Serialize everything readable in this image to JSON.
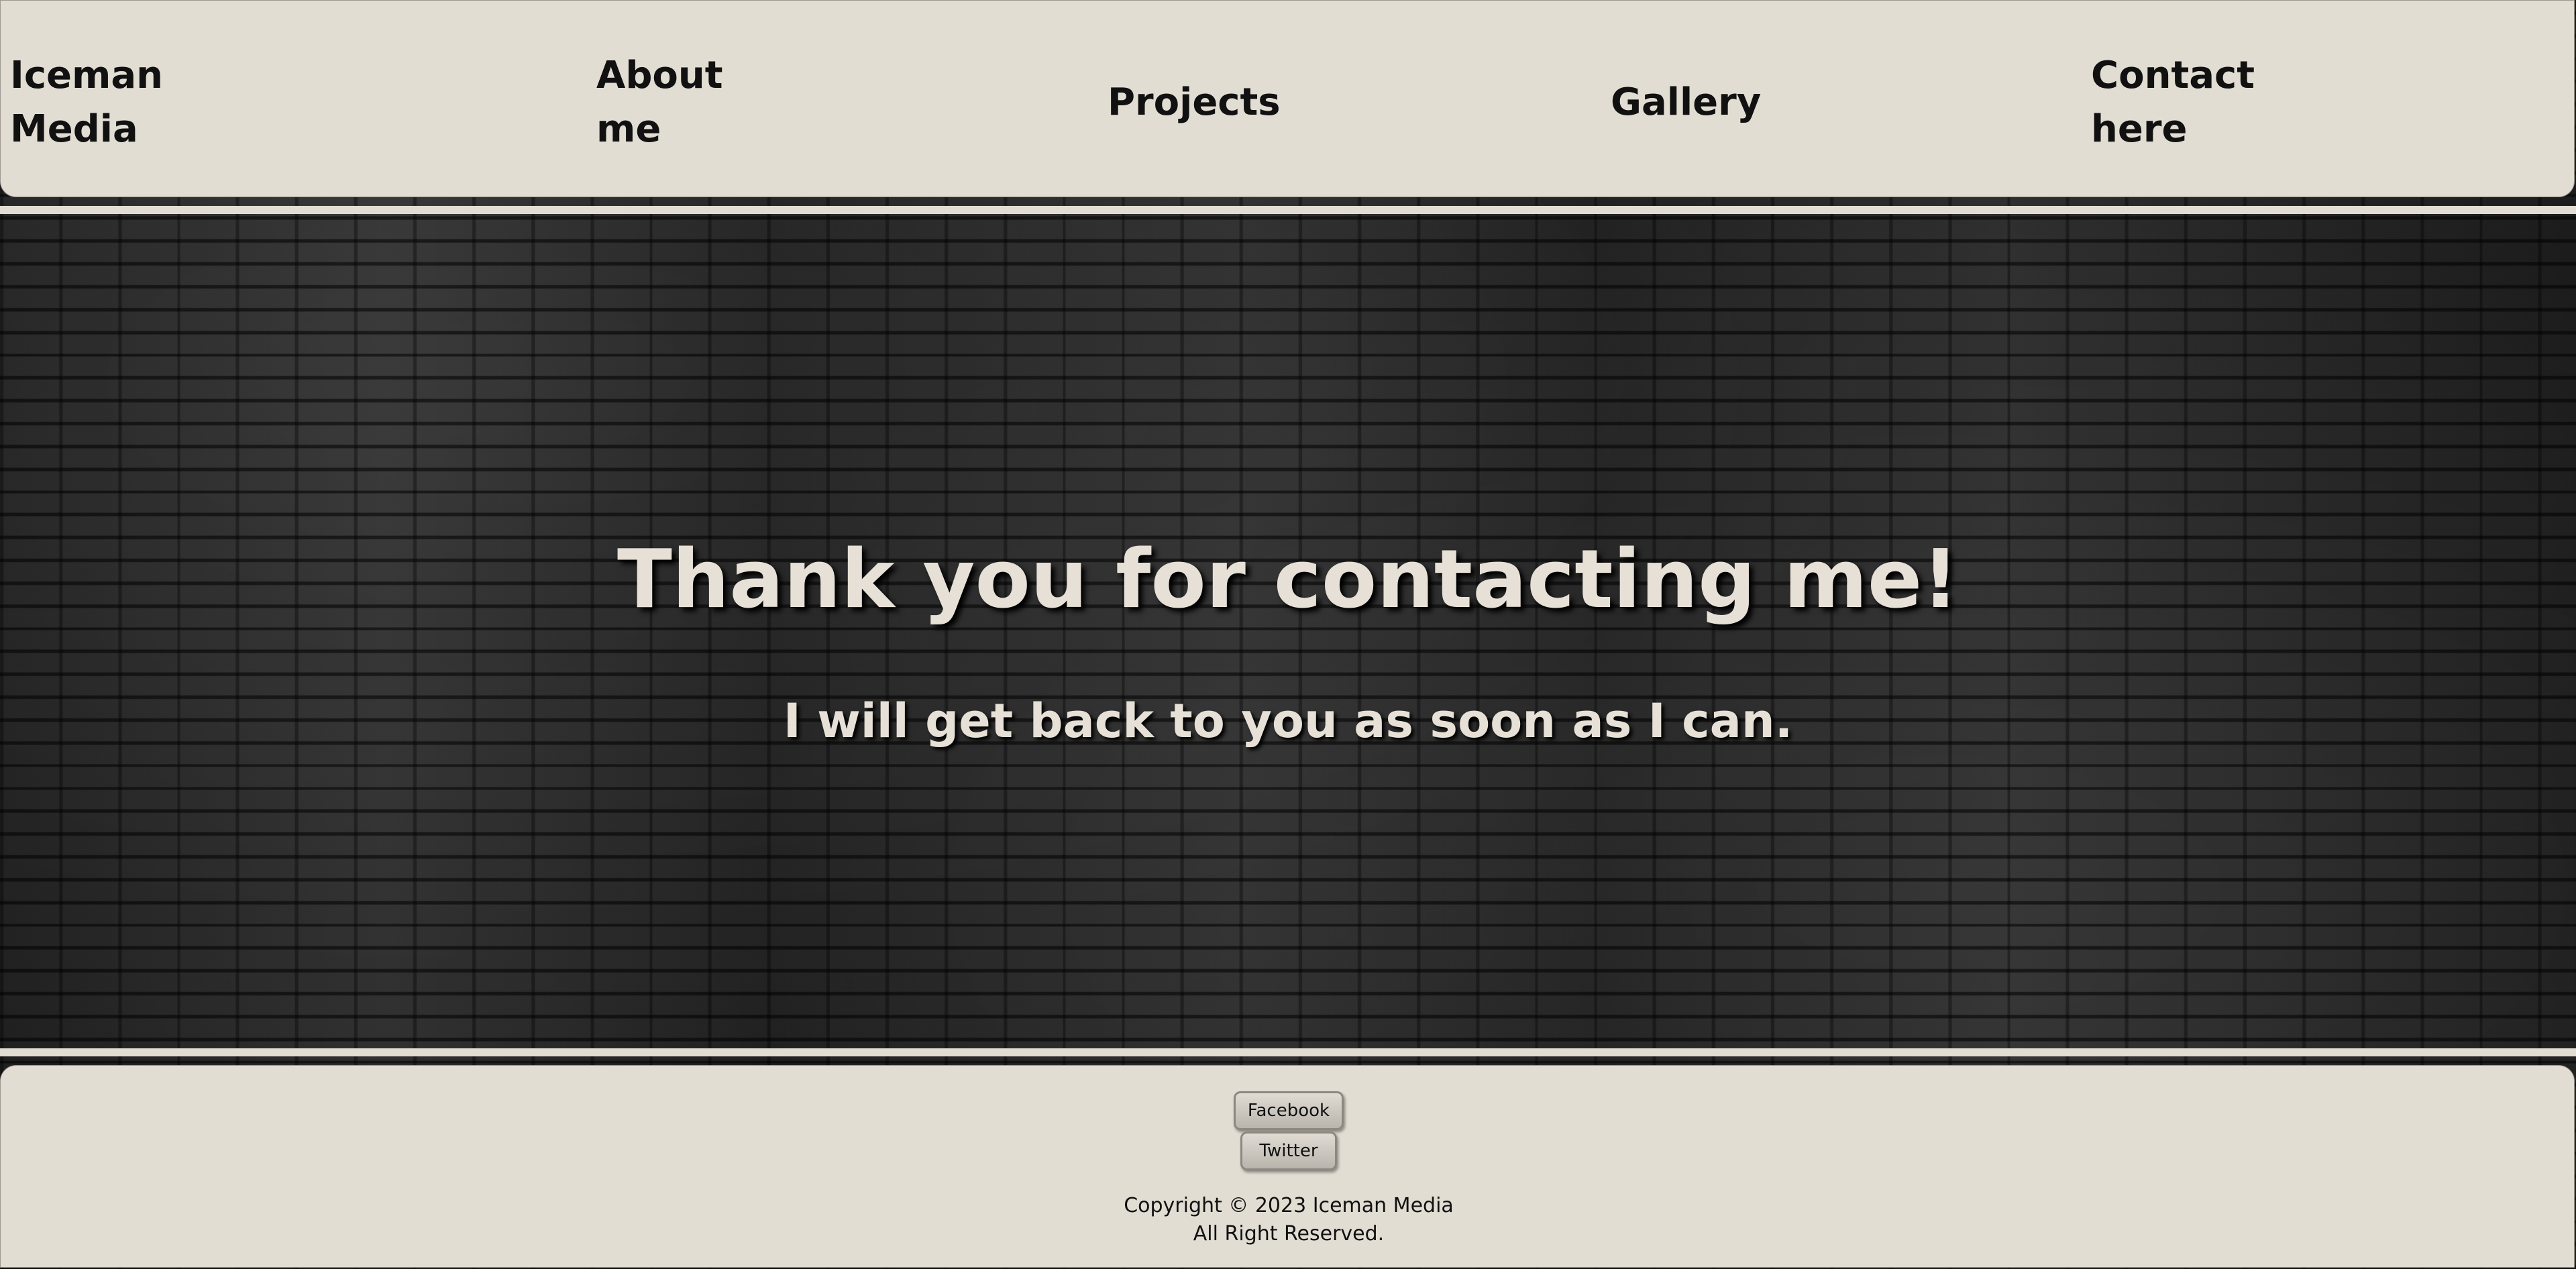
{
  "header": {
    "brand": [
      "Iceman",
      "Media"
    ],
    "nav": {
      "about": [
        "About",
        "me"
      ],
      "projects": "Projects",
      "gallery": "Gallery",
      "contact": [
        "Contact",
        "here"
      ]
    }
  },
  "main": {
    "title": "Thank you for contacting me!",
    "subtitle": "I will get back to you as soon as I can."
  },
  "footer": {
    "facebook_label": "Facebook",
    "twitter_label": "Twitter",
    "copyright_line1": "Copyright © 2023 Iceman Media",
    "copyright_line2": "All Right Reserved."
  },
  "colors": {
    "panel": "#e2ddd3",
    "hero_text": "#e6e0d6",
    "nav_text": "#111111"
  }
}
